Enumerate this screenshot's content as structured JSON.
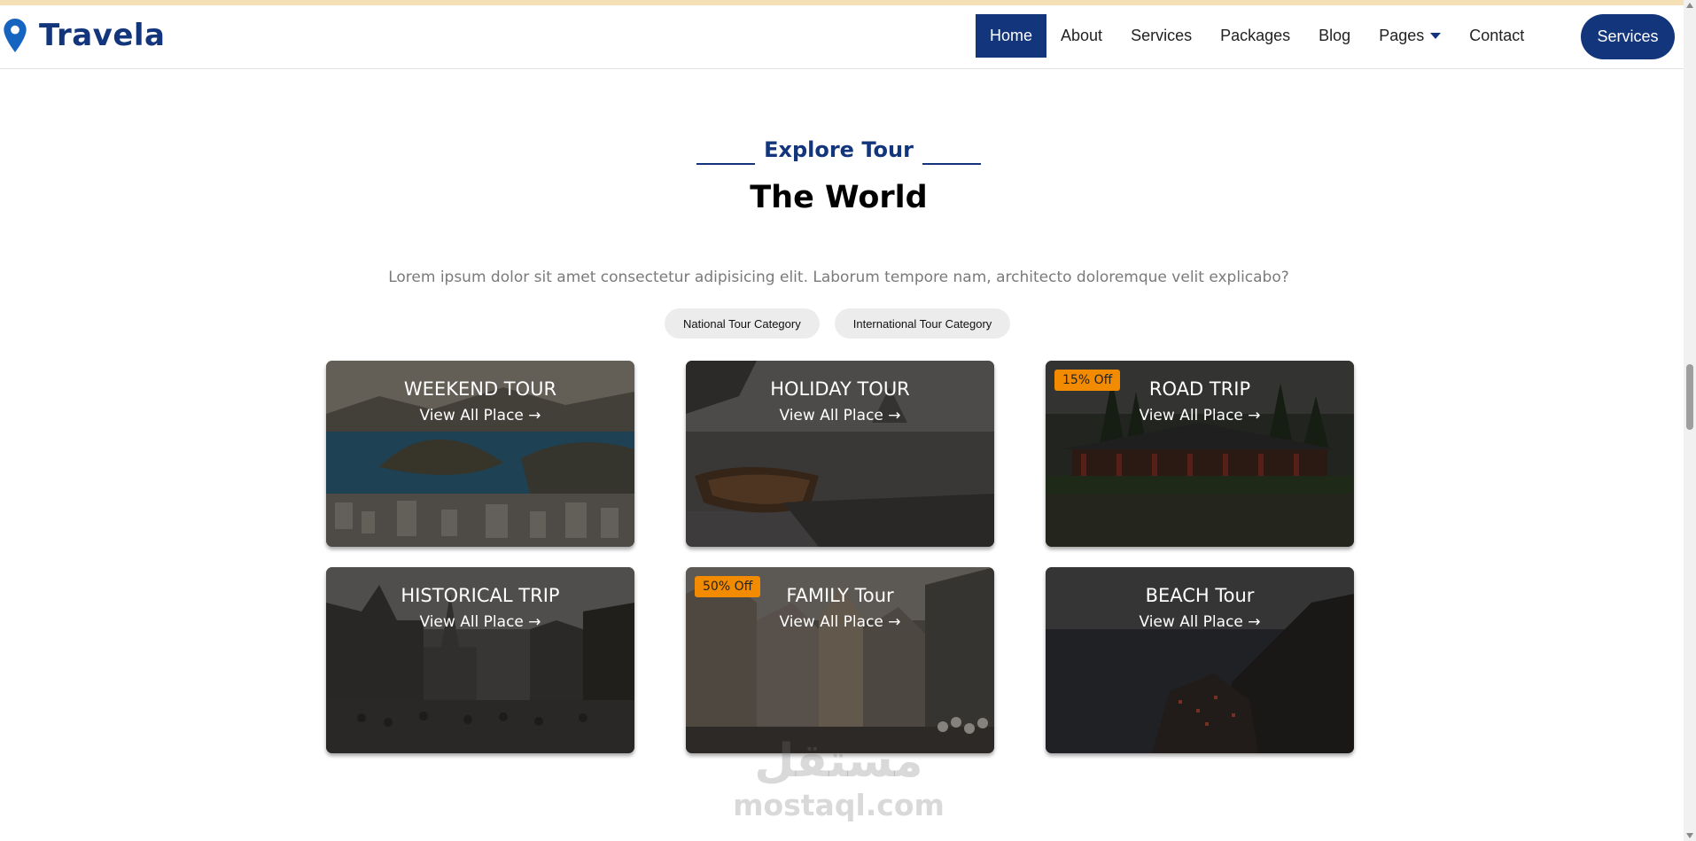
{
  "brand": {
    "name": "Travela",
    "icon": "map-pin-icon",
    "color": "#13357b"
  },
  "nav": {
    "items": [
      {
        "label": "Home",
        "active": true
      },
      {
        "label": "About"
      },
      {
        "label": "Services"
      },
      {
        "label": "Packages"
      },
      {
        "label": "Blog"
      },
      {
        "label": "Pages",
        "dropdown": true
      },
      {
        "label": "Contact"
      }
    ],
    "button_label": "Services"
  },
  "section": {
    "subtitle": "Explore Tour",
    "title": "The World",
    "description": "Lorem ipsum dolor sit amet consectetur adipisicing elit. Laborum tempore nam, architecto doloremque velit explicabo?",
    "tabs": [
      "National Tour Category",
      "International Tour Category"
    ]
  },
  "cards": [
    {
      "title": "WEEKEND TOUR",
      "link": "View All Place →",
      "badge": ""
    },
    {
      "title": "HOLIDAY TOUR",
      "link": "View All Place →",
      "badge": ""
    },
    {
      "title": "ROAD TRIP",
      "link": "View All Place →",
      "badge": "15% Off"
    },
    {
      "title": "HISTORICAL TRIP",
      "link": "View All Place →",
      "badge": ""
    },
    {
      "title": "FAMILY Tour",
      "link": "View All Place →",
      "badge": "50% Off"
    },
    {
      "title": "BEACH Tour",
      "link": "View All Place →",
      "badge": ""
    }
  ],
  "watermark": {
    "arabic": "مستقل",
    "latin": "mostaql.com"
  },
  "colors": {
    "primary": "#13357b",
    "badge": "#f28b00",
    "tab_bg": "#ececec"
  }
}
